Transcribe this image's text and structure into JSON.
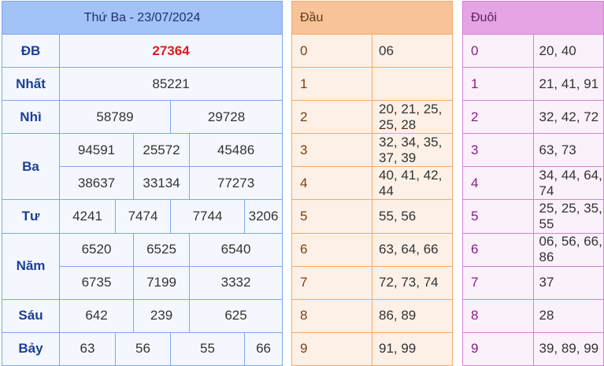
{
  "results": {
    "title": "Thứ Ba - 23/07/2024",
    "prizes": {
      "db": {
        "label": "ĐB",
        "values": [
          "27364"
        ]
      },
      "nhat": {
        "label": "Nhất",
        "values": [
          "85221"
        ]
      },
      "nhi": {
        "label": "Nhì",
        "values": [
          "58789",
          "29728"
        ]
      },
      "ba": {
        "label": "Ba",
        "values": [
          "94591",
          "25572",
          "45486",
          "38637",
          "33134",
          "77273"
        ]
      },
      "tu": {
        "label": "Tư",
        "values": [
          "4241",
          "7474",
          "7744",
          "3206"
        ]
      },
      "nam": {
        "label": "Năm",
        "values": [
          "6520",
          "6525",
          "6540",
          "6735",
          "7199",
          "3332"
        ]
      },
      "sau": {
        "label": "Sáu",
        "values": [
          "642",
          "239",
          "625"
        ]
      },
      "bay": {
        "label": "Bảy",
        "values": [
          "63",
          "56",
          "55",
          "66"
        ]
      }
    }
  },
  "dau": {
    "header": "Đầu",
    "rows": [
      {
        "key": "0",
        "value": "06"
      },
      {
        "key": "1",
        "value": ""
      },
      {
        "key": "2",
        "value": "20, 21, 25, 25, 28"
      },
      {
        "key": "3",
        "value": "32, 34, 35, 37, 39"
      },
      {
        "key": "4",
        "value": "40, 41, 42, 44"
      },
      {
        "key": "5",
        "value": "55, 56"
      },
      {
        "key": "6",
        "value": "63, 64, 66"
      },
      {
        "key": "7",
        "value": "72, 73, 74"
      },
      {
        "key": "8",
        "value": "86, 89"
      },
      {
        "key": "9",
        "value": "91, 99"
      }
    ]
  },
  "duoi": {
    "header": "Đuôi",
    "rows": [
      {
        "key": "0",
        "value": "20, 40"
      },
      {
        "key": "1",
        "value": "21, 41, 91"
      },
      {
        "key": "2",
        "value": "32, 42, 72"
      },
      {
        "key": "3",
        "value": "63, 73"
      },
      {
        "key": "4",
        "value": "34, 44, 64, 74"
      },
      {
        "key": "5",
        "value": "25, 25, 35, 55"
      },
      {
        "key": "6",
        "value": "06, 56, 66, 86"
      },
      {
        "key": "7",
        "value": "37"
      },
      {
        "key": "8",
        "value": "28"
      },
      {
        "key": "9",
        "value": "39, 89, 99"
      }
    ]
  }
}
